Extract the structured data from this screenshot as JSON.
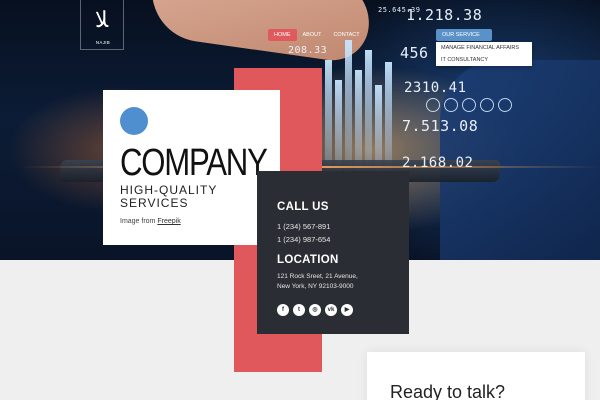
{
  "nav": {
    "items": [
      "HOME",
      "ABOUT",
      "CONTACT"
    ],
    "service_label": "OUR SERVICE",
    "service_caret": "▾",
    "dropdown": [
      "MANAGE FINANCIAL AFFAIRS",
      "IT CONSULTANCY"
    ]
  },
  "logo": {
    "glyph": "ﻼ",
    "text": "NAJIB"
  },
  "hero_numbers": [
    "25.645.39",
    "1.218.38",
    "208.33",
    "456",
    "2310.41",
    "7.513.08",
    "2.168.02"
  ],
  "card": {
    "title": "COMPANY",
    "subtitle": "HIGH-QUALITY SERVICES",
    "credit_prefix": "Image from",
    "credit_link": "Freepik"
  },
  "contact": {
    "call_title": "CALL US",
    "phones": [
      "1 (234) 567-891",
      "1 (234) 987-654"
    ],
    "location_title": "LOCATION",
    "address_lines": [
      "121 Rock Sreet, 21 Avenue,",
      "New York, NY 92103-9000"
    ],
    "socials": [
      "f",
      "t",
      "◎",
      "vk",
      "▶"
    ]
  },
  "ready": {
    "title": "Ready to talk?"
  },
  "colors": {
    "accent_red": "#e0575c",
    "accent_blue": "#5b91c9",
    "dark_card": "#2a2d33"
  }
}
